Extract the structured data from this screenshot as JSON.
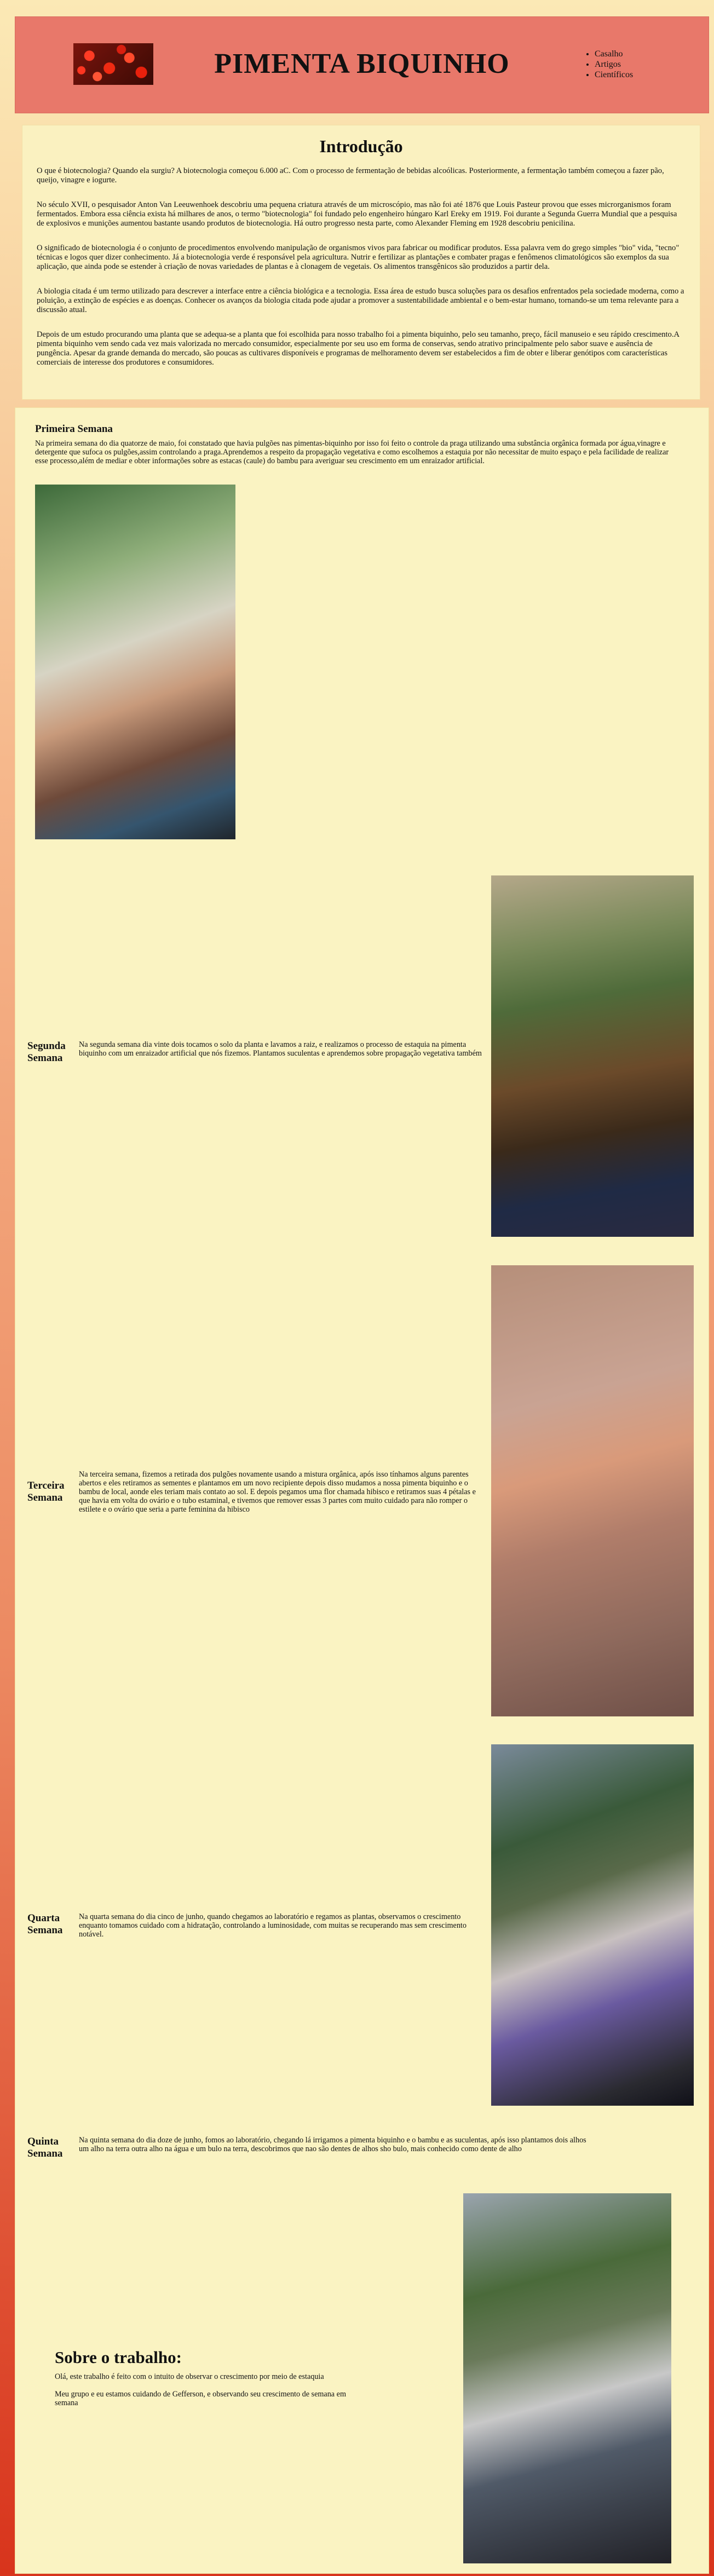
{
  "header": {
    "title": "PIMENTA BIQUINHO",
    "nav": [
      "Casalho",
      "Artigos",
      "Científicos"
    ]
  },
  "intro": {
    "title": "Introdução",
    "paragraphs": [
      "O que é biotecnologia? Quando ela surgiu? A biotecnologia começou 6.000 aC. Com o processo de fermentação de bebidas alcoólicas. Posteriormente, a fermentação também começou a fazer pão, queijo, vinagre e iogurte.",
      "No século XVII, o pesquisador Anton Van Leeuwenhoek descobriu uma pequena criatura através de um microscópio, mas não foi até 1876 que Louis Pasteur provou que esses microrganismos foram fermentados. Embora essa ciência exista há milhares de anos, o termo \"biotecnologia\" foi fundado pelo engenheiro húngaro Karl Ereky em 1919. Foi durante a Segunda Guerra Mundial que a pesquisa de explosivos e munições aumentou bastante usando produtos de biotecnologia. Há outro progresso nesta parte, como Alexander Fleming em 1928 descobriu penicilina.",
      "O significado de biotecnologia é o conjunto de procedimentos envolvendo manipulação de organismos vivos para fabricar ou modificar produtos. Essa palavra vem do grego simples \"bio\" vida, \"tecno\" técnicas e logos quer dizer conhecimento. Já a biotecnologia verde é responsável pela agricultura. Nutrir e fertilizar as plantações e combater pragas e fenômenos climatológicos são exemplos da sua aplicação, que ainda pode se estender à criação de novas variedades de plantas e à clonagem de vegetais. Os alimentos transgênicos são produzidos a partir dela.",
      "A biologia citada é um termo utilizado para descrever a interface entre a ciência biológica e a tecnologia. Essa área de estudo busca soluções para os desafios enfrentados pela sociedade moderna, como a poluição, a extinção de espécies e as doenças. Conhecer os avanços da biologia citada pode ajudar a promover a sustentabilidade ambiental e o bem-estar humano, tornando-se um tema relevante para a discussão atual.",
      "Depois de um estudo procurando uma planta que se adequa-se a planta que foi escolhida para nosso trabalho foi a pimenta biquinho, pelo seu tamanho, preço, fácil manuseio e seu rápido crescimento.A pimenta biquinho vem sendo cada vez mais valorizada no mercado consumidor, especialmente por seu uso em forma de conservas, sendo atrativo principalmente pelo sabor suave e ausência de pungência. Apesar da grande demanda do mercado, são poucas as cultivares disponíveis e programas de melhoramento devem ser estabelecidos a fim de obter e liberar genótipos com características comerciais de interesse dos produtores e consumidores."
    ]
  },
  "weeks": [
    {
      "label": "Primeira Semana",
      "text": "Na primeira semana do dia quatorze de maio, foi constatado que havia pulgões nas pimentas-biquinho por isso foi feito o controle da praga utilizando uma substância orgânica formada por água,vinagre e detergente que sufoca os pulgões,assim controlando a praga.Aprendemos a respeito da propagação vegetativa e como escolhemos a estaquia por não necessitar de muito espaço e pela facilidade de realizar esse processo,além de mediar e obter informações sobre as estacas (caule) do bambu para averiguar seu crescimento em um enraizador artificial."
    },
    {
      "label": "Segunda Semana",
      "text": "Na segunda semana dia vinte dois tocamos o solo da planta e lavamos a raiz, e realizamos o processo de estaquia na pimenta biquinho com um enraizador artificial que nós fizemos. Plantamos suculentas e aprendemos sobre propagação vegetativa também"
    },
    {
      "label": "Terceira Semana",
      "text": "Na terceira semana, fizemos a retirada dos pulgões novamente usando a mistura orgânica, após isso tínhamos alguns parentes abertos e eles retiramos as sementes e plantamos em um novo recipiente depois disso mudamos a nossa pimenta biquinho e o bambu de local, aonde eles teriam mais contato ao sol. E depois pegamos uma flor chamada hibisco e retiramos suas 4 pétalas e que havia em volta do ovário e o tubo estaminal, e tivemos que remover essas 3 partes com muito cuidado para não romper o estilete e o ovário que seria a parte feminina da hibisco"
    },
    {
      "label": "Quarta Semana",
      "text": "Na quarta semana do dia cinco de junho, quando chegamos ao laboratório e regamos as plantas, observamos o crescimento enquanto tomamos cuidado com a hidratação, controlando a luminosidade, com muitas se recuperando mas sem crescimento notável."
    },
    {
      "label": "Quinta Semana",
      "text": "Na quinta semana do dia doze de junho, fomos ao laboratório, chegando lá irrigamos a pimenta biquinho e o bambu e as suculentas, após isso plantamos dois alhos um alho na terra outra alho na água e um bulo na terra, descobrimos que nao são dentes de alhos sho bulo, mais conhecido como dente de alho"
    }
  ],
  "about": {
    "title": "Sobre o trabalho:",
    "paragraphs": [
      "Olá, este trabalho é feito com o intuito de observar o crescimento por meio de estaquia",
      "Meu grupo e eu estamos cuidando de Gefferson, e observando seu crescimento de semana em semana"
    ]
  }
}
